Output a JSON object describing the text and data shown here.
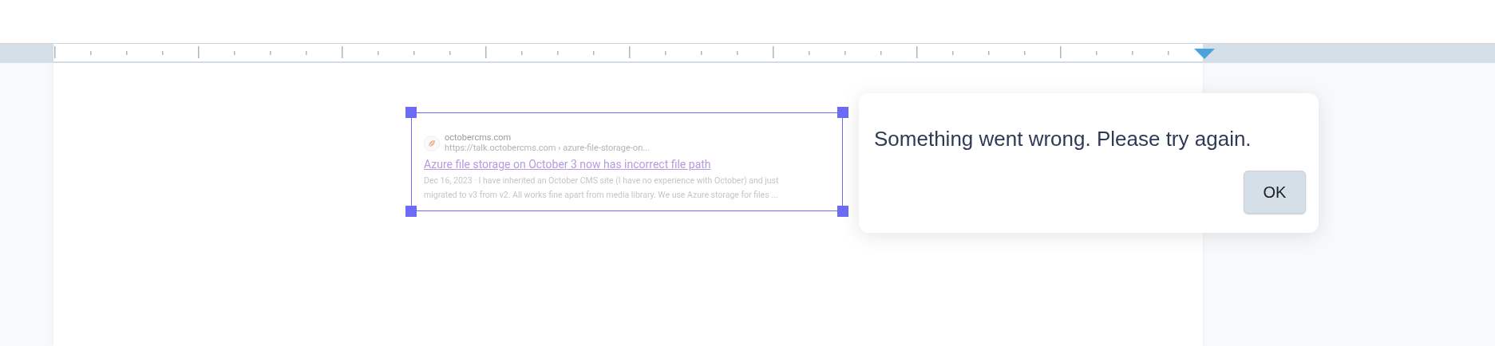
{
  "search_result": {
    "site": "octobercms.com",
    "url": "https://talk.octobercms.com › azure-file-storage-on...",
    "title": "Azure file storage on October 3 now has incorrect file path",
    "snippet": "Dec 16, 2023 · I have inherited an October CMS site (I have no experience with October) and just migrated to v3 from v2. All works fine apart from media library. We use Azure storage for files ..."
  },
  "dialog": {
    "message": "Something went wrong. Please try again.",
    "buttons": [
      "OK"
    ]
  }
}
